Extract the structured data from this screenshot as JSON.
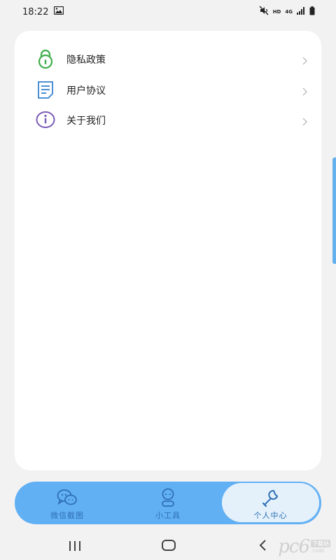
{
  "status_bar": {
    "time": "18:22",
    "network": "HD",
    "network_gen": "4G"
  },
  "menu": {
    "items": [
      {
        "label": "隐私政策",
        "icon": "lock-icon",
        "color": "#3fae49"
      },
      {
        "label": "用户协议",
        "icon": "document-icon",
        "color": "#4b8fd6"
      },
      {
        "label": "关于我们",
        "icon": "info-icon",
        "color": "#7a5ab8"
      }
    ]
  },
  "bottom_nav": {
    "tabs": [
      {
        "label": "微信截图",
        "icon": "chat-bubbles-icon",
        "active": false
      },
      {
        "label": "小工具",
        "icon": "robot-icon",
        "active": false
      },
      {
        "label": "个人中心",
        "icon": "wrench-icon",
        "active": true
      }
    ]
  },
  "colors": {
    "accent": "#62b0f4",
    "active_tab_bg": "#e4f1fb",
    "card_bg": "#ffffff",
    "page_bg": "#f2f2f2"
  },
  "watermark": {
    "main": "pc6",
    "badge": "下载站",
    "domain": ".com"
  }
}
